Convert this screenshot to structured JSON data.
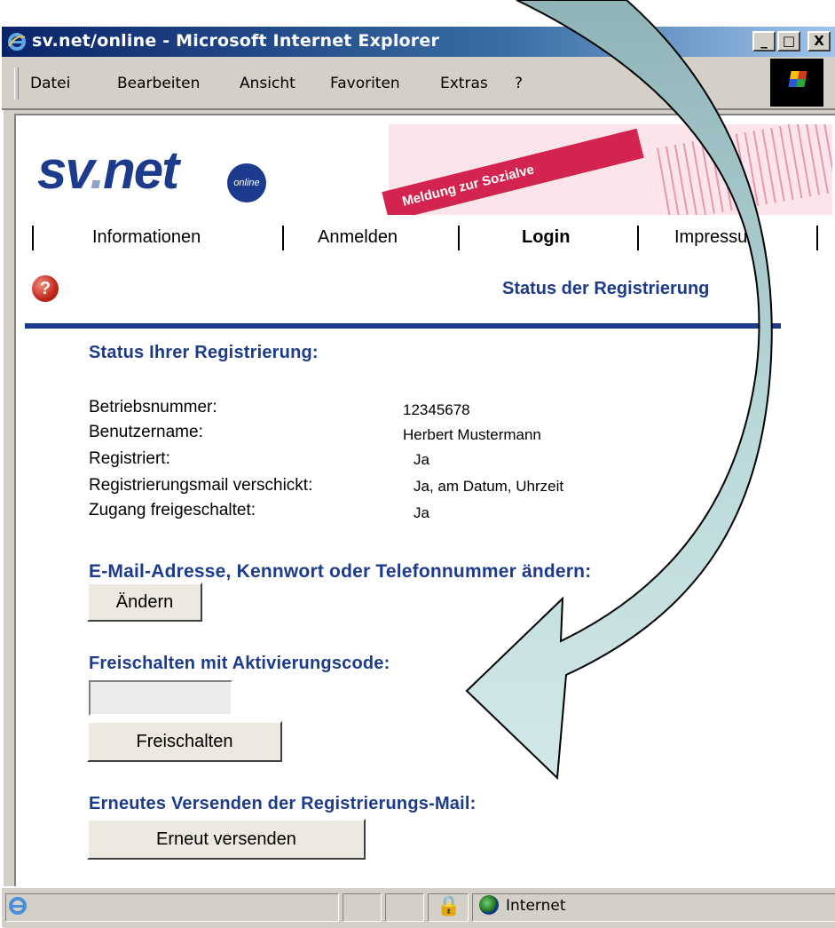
{
  "window": {
    "title": "sv.net/online - Microsoft Internet Explorer",
    "controls": {
      "minimize": "_",
      "maximize": "□",
      "close": "X"
    }
  },
  "menubar": {
    "items": [
      "Datei",
      "Bearbeiten",
      "Ansicht",
      "Favoriten",
      "Extras",
      "?"
    ]
  },
  "banner": {
    "logo_sv": "sv",
    "logo_dot": ".",
    "logo_net": "net",
    "logo_badge": "online",
    "form_stripe_text": "Meldung zur Sozialve"
  },
  "nav": {
    "items": [
      {
        "label": "Informationen",
        "active": false
      },
      {
        "label": "Anmelden",
        "active": false
      },
      {
        "label": "Login",
        "active": true
      },
      {
        "label": "Impressum",
        "active": false
      }
    ]
  },
  "page": {
    "heading": "Status der Registrierung",
    "help_icon": "question-icon"
  },
  "status": {
    "heading": "Status Ihrer Registrierung:",
    "rows": [
      {
        "label": "Betriebsnummer:",
        "value": "12345678"
      },
      {
        "label": "Benutzername:",
        "value": "Herbert Mustermann"
      },
      {
        "label": "Registriert:",
        "value": "Ja"
      },
      {
        "label": "Registrierungsmail verschickt:",
        "value": "Ja, am Datum, Uhrzeit"
      },
      {
        "label": "Zugang freigeschaltet:",
        "value": "Ja"
      }
    ]
  },
  "change_section": {
    "heading": "E-Mail-Adresse, Kennwort oder Telefonnummer ändern:",
    "button_label": "Ändern"
  },
  "activation_section": {
    "heading": "Freischalten mit Aktivierungscode:",
    "input_value": "",
    "button_label": "Freischalten"
  },
  "resend_section": {
    "heading": "Erneutes Versenden der Registrierungs-Mail:",
    "button_label": "Erneut versenden"
  },
  "statusbar": {
    "zone_text": "Internet"
  },
  "colors": {
    "accent": "#1d3b8c",
    "arrow_fill": "#9fc6c9",
    "arrow_fill_light": "#d3e8e8"
  }
}
